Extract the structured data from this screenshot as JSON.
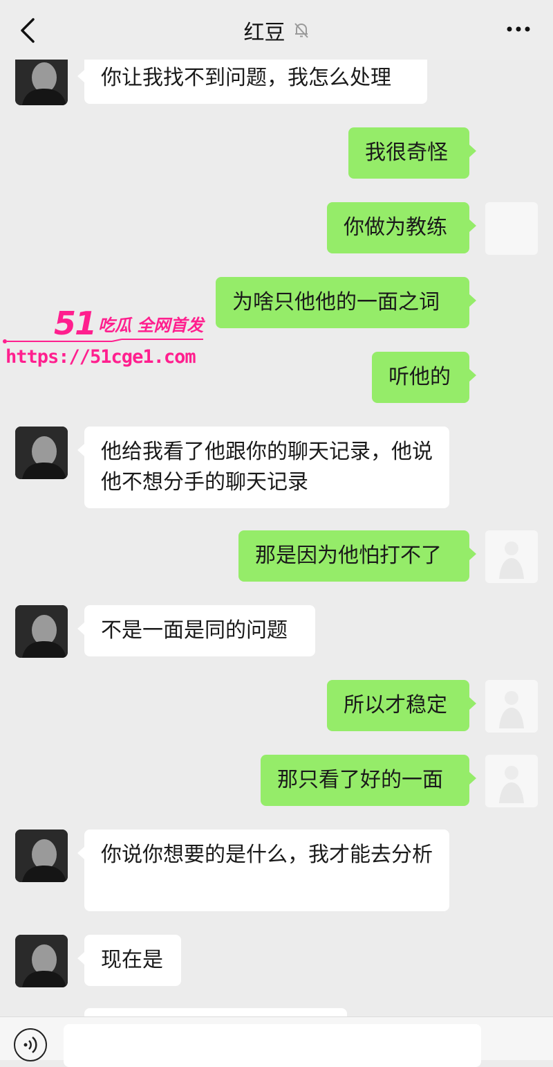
{
  "header": {
    "title": "红豆",
    "back_icon": "chevron-left-icon",
    "mute_icon": "bell-off-icon",
    "more_icon": "more-dots-icon"
  },
  "messages": [
    {
      "from": "them",
      "text": "你让我找不到问题，我怎么处理"
    },
    {
      "from": "me",
      "text": "我很奇怪"
    },
    {
      "from": "me",
      "text": "你做为教练"
    },
    {
      "from": "me",
      "text": "为啥只他他的一面之词"
    },
    {
      "from": "me",
      "text": "听他的"
    },
    {
      "from": "them",
      "text": "他给我看了他跟你的聊天记录，他说他不想分手的聊天记录"
    },
    {
      "from": "me",
      "text": "那是因为他怕打不了"
    },
    {
      "from": "them",
      "text": "不是一面是同的问题"
    },
    {
      "from": "me",
      "text": "所以才稳定"
    },
    {
      "from": "me",
      "text": "那只看了好的一面"
    },
    {
      "from": "them",
      "text": "你说你想要的是什么，我才能去分析"
    },
    {
      "from": "them",
      "text": "现在是"
    }
  ],
  "watermark": {
    "number": "51",
    "text": "吃瓜 全网首发",
    "url": "https://51cge1.com"
  },
  "input_bar": {
    "voice_icon": "voice-icon",
    "input_value": ""
  },
  "colors": {
    "background": "#ececec",
    "bubble_in": "#ffffff",
    "bubble_out": "#95ec69",
    "watermark": "#ff1f8e"
  }
}
